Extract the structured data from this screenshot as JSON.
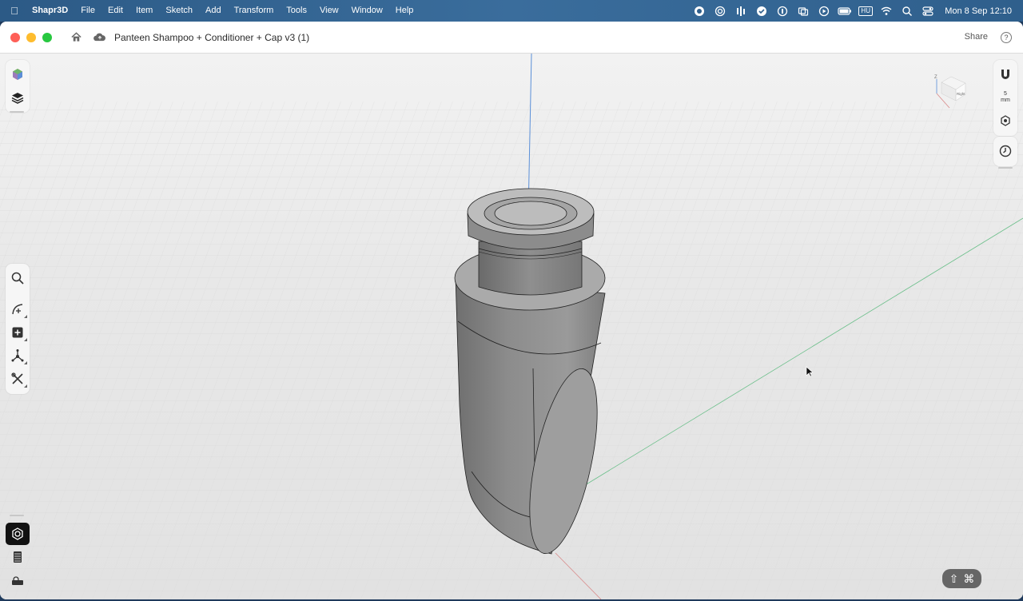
{
  "menubar": {
    "app_name": "Shapr3D",
    "items": [
      "File",
      "Edit",
      "Item",
      "Sketch",
      "Add",
      "Transform",
      "Tools",
      "View",
      "Window",
      "Help"
    ],
    "input_source": "HU",
    "clock": "Mon 8 Sep  12:10"
  },
  "titlebar": {
    "document_title": "Panteen Shampoo + Conditioner + Cap v3 (1)",
    "share_label": "Share",
    "help_label": "?"
  },
  "right_toolbar": {
    "snap_value": "5",
    "snap_unit": "mm"
  },
  "view_cube": {
    "face_label": "Right",
    "axis_label": "Z"
  },
  "keyboard_modifiers": {
    "shift": "⇧",
    "command": "⌘"
  },
  "colors": {
    "menubar": "#2f5f8c",
    "model_gray": "#8a8a8a",
    "z_axis": "#5a8fd8",
    "y_axis": "#6bbf8a",
    "x_axis": "#d98a8a"
  }
}
